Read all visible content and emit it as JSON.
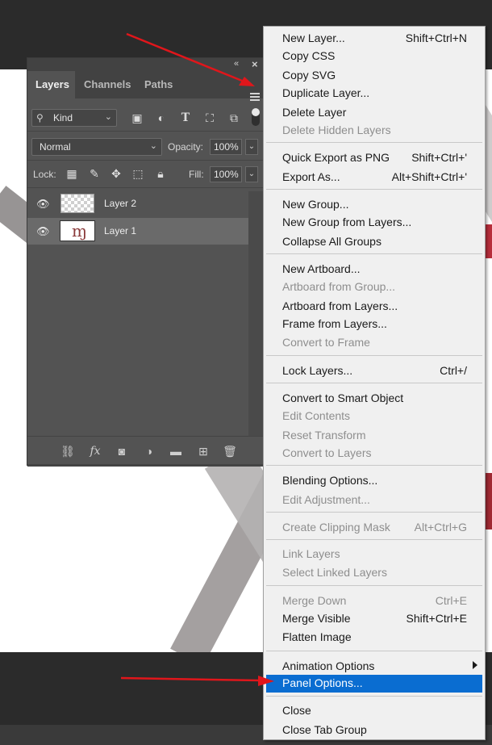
{
  "panel": {
    "tabs": [
      {
        "label": "Layers",
        "active": true
      },
      {
        "label": "Channels",
        "active": false
      },
      {
        "label": "Paths",
        "active": false
      }
    ],
    "filter_kind": "Kind",
    "blend_mode": "Normal",
    "opacity_label": "Opacity:",
    "opacity_value": "100%",
    "lock_label": "Lock:",
    "fill_label": "Fill:",
    "fill_value": "100%",
    "layers": [
      {
        "name": "Layer 2",
        "visible": true,
        "selected": false
      },
      {
        "name": "Layer 1",
        "visible": true,
        "selected": true
      }
    ],
    "collapse_glyph": "«",
    "close_glyph": "×"
  },
  "menu": {
    "items": [
      {
        "label": "New Layer...",
        "shortcut": "Shift+Ctrl+N",
        "disabled": false
      },
      {
        "label": "Copy CSS",
        "shortcut": "",
        "disabled": false
      },
      {
        "label": "Copy SVG",
        "shortcut": "",
        "disabled": false
      },
      {
        "label": "Duplicate Layer...",
        "shortcut": "",
        "disabled": false
      },
      {
        "label": "Delete Layer",
        "shortcut": "",
        "disabled": false
      },
      {
        "label": "Delete Hidden Layers",
        "shortcut": "",
        "disabled": true
      },
      {
        "label": "Quick Export as PNG",
        "shortcut": "Shift+Ctrl+'",
        "disabled": false
      },
      {
        "label": "Export As...",
        "shortcut": "Alt+Shift+Ctrl+'",
        "disabled": false
      },
      {
        "label": "New Group...",
        "shortcut": "",
        "disabled": false
      },
      {
        "label": "New Group from Layers...",
        "shortcut": "",
        "disabled": false
      },
      {
        "label": "Collapse All Groups",
        "shortcut": "",
        "disabled": false
      },
      {
        "label": "New Artboard...",
        "shortcut": "",
        "disabled": false
      },
      {
        "label": "Artboard from Group...",
        "shortcut": "",
        "disabled": true
      },
      {
        "label": "Artboard from Layers...",
        "shortcut": "",
        "disabled": false
      },
      {
        "label": "Frame from Layers...",
        "shortcut": "",
        "disabled": false
      },
      {
        "label": "Convert to Frame",
        "shortcut": "",
        "disabled": true
      },
      {
        "label": "Lock Layers...",
        "shortcut": "Ctrl+/",
        "disabled": false
      },
      {
        "label": "Convert to Smart Object",
        "shortcut": "",
        "disabled": false
      },
      {
        "label": "Edit Contents",
        "shortcut": "",
        "disabled": true
      },
      {
        "label": "Reset Transform",
        "shortcut": "",
        "disabled": true
      },
      {
        "label": "Convert to Layers",
        "shortcut": "",
        "disabled": true
      },
      {
        "label": "Blending Options...",
        "shortcut": "",
        "disabled": false
      },
      {
        "label": "Edit Adjustment...",
        "shortcut": "",
        "disabled": true
      },
      {
        "label": "Create Clipping Mask",
        "shortcut": "Alt+Ctrl+G",
        "disabled": true
      },
      {
        "label": "Link Layers",
        "shortcut": "",
        "disabled": true
      },
      {
        "label": "Select Linked Layers",
        "shortcut": "",
        "disabled": true
      },
      {
        "label": "Merge Down",
        "shortcut": "Ctrl+E",
        "disabled": true
      },
      {
        "label": "Merge Visible",
        "shortcut": "Shift+Ctrl+E",
        "disabled": false
      },
      {
        "label": "Flatten Image",
        "shortcut": "",
        "disabled": false
      },
      {
        "label": "Animation Options",
        "shortcut": "",
        "disabled": false,
        "submenu": true
      },
      {
        "label": "Panel Options...",
        "shortcut": "",
        "disabled": false,
        "highlighted": true
      },
      {
        "label": "Close",
        "shortcut": "",
        "disabled": false
      },
      {
        "label": "Close Tab Group",
        "shortcut": "",
        "disabled": false
      }
    ]
  },
  "colors": {
    "highlight": "#0a6dd1",
    "annotation_arrow": "#e0161b",
    "panel_bg": "#535353"
  }
}
